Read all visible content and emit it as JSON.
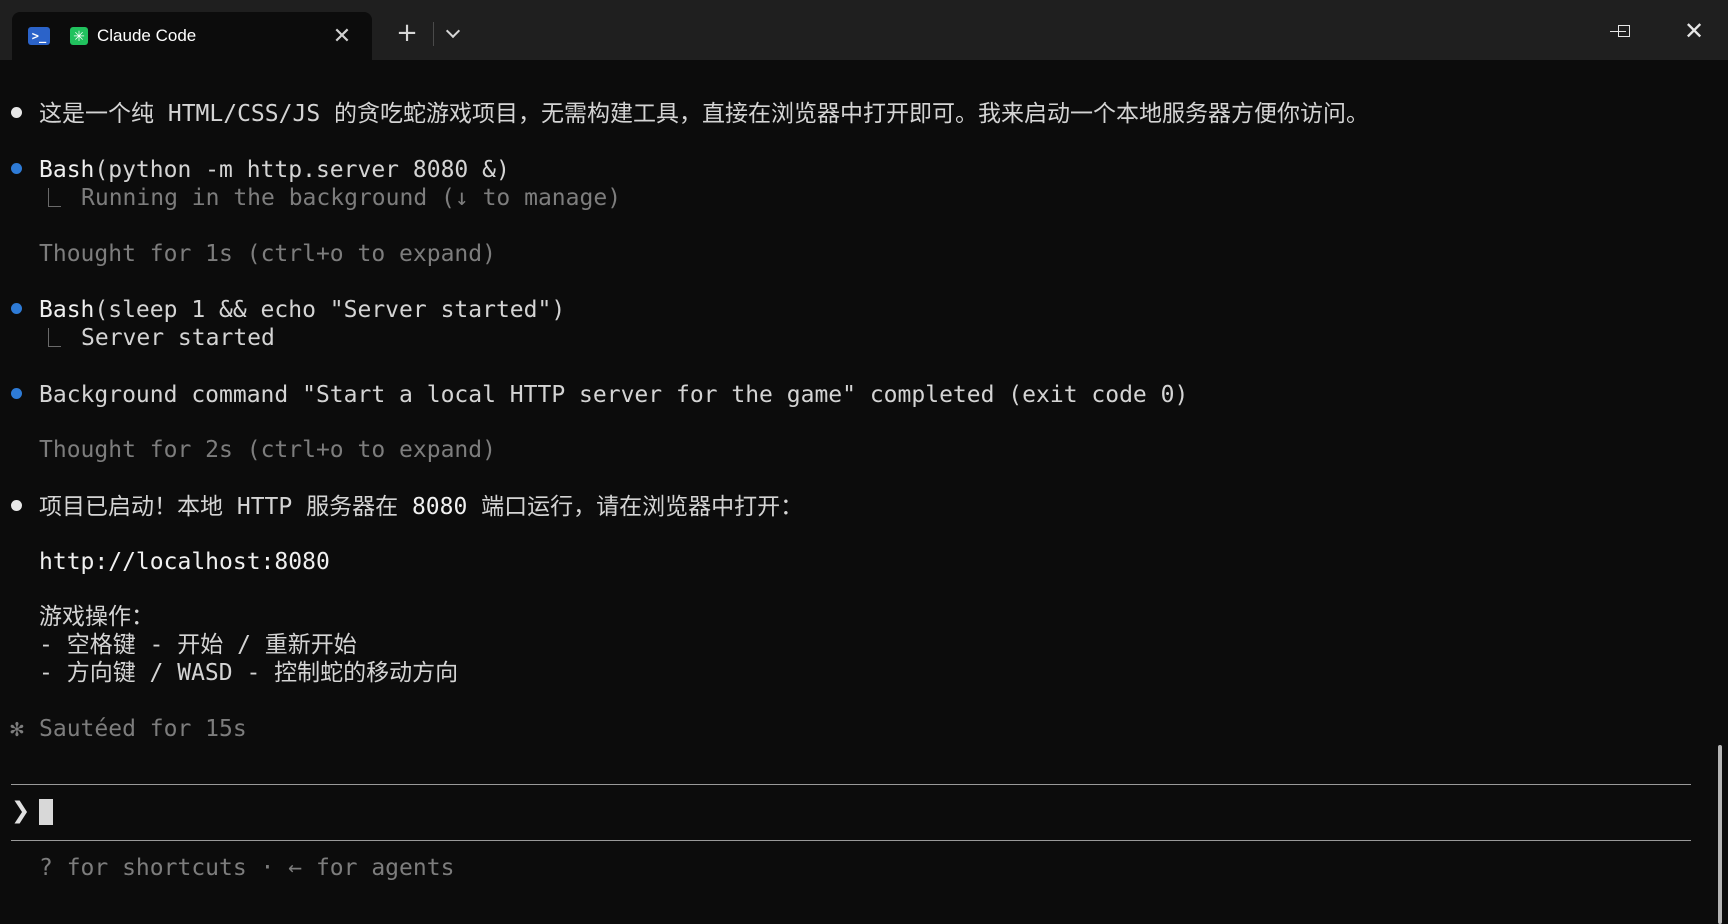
{
  "window": {
    "tab_title": "Claude Code",
    "shell_icon_glyph": ">_",
    "app_icon_glyph": "✳",
    "close_tab_glyph": "✕",
    "new_tab_glyph": "+",
    "close_window_glyph": "✕"
  },
  "colors": {
    "background": "#0c0c0c",
    "titlebar": "#1f1f1f",
    "tool_bullet": "#2e7bd6",
    "text_bullet": "#e8e8e8",
    "dim_text": "#7d7d7d"
  },
  "transcript": {
    "message_1": "这是一个纯 HTML/CSS/JS 的贪吃蛇游戏项目，无需构建工具，直接在浏览器中打开即可。我来启动一个本地服务器方便你访问。",
    "tool_1": {
      "name": "Bash",
      "args": "(python -m http.server 8080 &)",
      "output": "Running in the background (↓ to manage)"
    },
    "thought_1": {
      "prefix": "Thought for ",
      "duration": "1s",
      "suffix": " (ctrl+o to expand)"
    },
    "tool_2": {
      "name": "Bash",
      "args": "(sleep 1 && echo \"Server started\")",
      "output": "Server started"
    },
    "background_notice": "Background command \"Start a local HTTP server for the game\" completed (exit code 0)",
    "thought_2": {
      "prefix": "Thought for ",
      "duration": "2s",
      "suffix": " (ctrl+o to expand)"
    },
    "message_2": {
      "part_a": "项目已启动！本地 HTTP 服务器在 ",
      "port": "8080",
      "part_b": " 端口运行，请在浏览器中打开：",
      "url": "http://localhost:8080",
      "controls_heading": "游戏操作：",
      "controls": [
        "- 空格键 - 开始 / 重新开始",
        "- 方向键 / WASD - 控制蛇的移动方向"
      ]
    },
    "status": {
      "spinner_glyph": "✻",
      "text": "Sautéed for 15s"
    }
  },
  "prompt": {
    "glyph": "❯",
    "input_value": ""
  },
  "footer": {
    "hint": "? for shortcuts · ← for agents"
  }
}
